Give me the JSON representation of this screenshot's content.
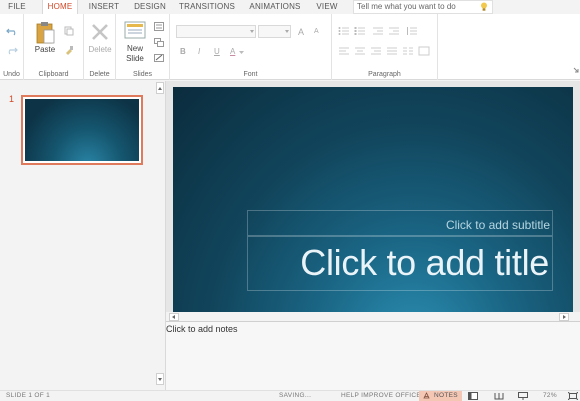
{
  "tabs": [
    {
      "label": "FILE",
      "active": false
    },
    {
      "label": "HOME",
      "active": true
    },
    {
      "label": "INSERT",
      "active": false
    },
    {
      "label": "DESIGN",
      "active": false
    },
    {
      "label": "TRANSITIONS",
      "active": false
    },
    {
      "label": "ANIMATIONS",
      "active": false
    },
    {
      "label": "VIEW",
      "active": false
    }
  ],
  "search": {
    "placeholder": "Tell me what you want to do",
    "icon": "lightbulb-icon"
  },
  "ribbon": {
    "groups": {
      "undo": "Undo",
      "clipboard": "Clipboard",
      "delete": "Delete",
      "slides": "Slides",
      "font": "Font",
      "paragraph": "Paragraph"
    },
    "paste_label": "Paste",
    "delete_label": "Delete",
    "new_slide_label_1": "New",
    "new_slide_label_2": "Slide",
    "bold": "B",
    "italic": "I",
    "underline": "U",
    "font_color": "A",
    "grow_font": "A",
    "shrink_font": "A"
  },
  "thumbnails": {
    "slide_number": "1"
  },
  "slide": {
    "subtitle_placeholder": "Click to add subtitle",
    "title_placeholder": "Click to add title"
  },
  "notes": {
    "placeholder": "Click to add notes"
  },
  "status": {
    "slide_counter": "SLIDE 1 OF 1",
    "saving": "SAVING...",
    "help_improve": "HELP IMPROVE OFFICE",
    "notes_button": "NOTES",
    "zoom": "72%"
  },
  "colors": {
    "accent": "#d24726",
    "slide_bg_dark": "#0b2c3d",
    "slide_bg_light": "#2b8fb3"
  }
}
